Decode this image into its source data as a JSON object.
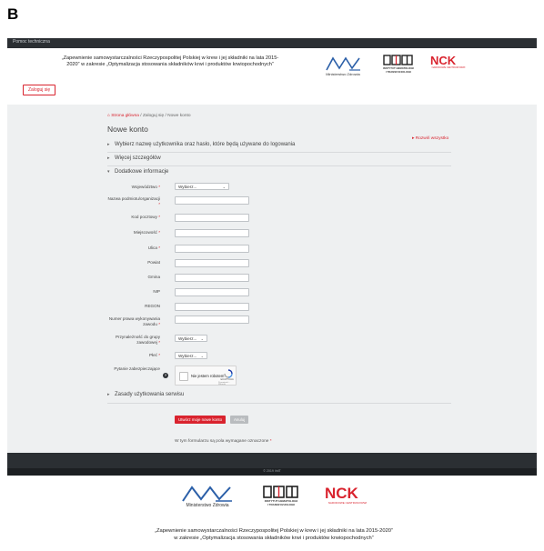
{
  "panel_letter": "B",
  "topbar": {
    "help_label": "Pomoc techniczna"
  },
  "header": {
    "tagline_line1": "„Zapewnienie samowystarczalności Rzeczypospolitej Polskiej w krew i jej składniki na lata 2015-",
    "tagline_line2": "2020” w zakresie „Optymalizacja stosowania składników krwi i produktów krwiopochodnych”",
    "login_button": "Zaloguj się",
    "logos": {
      "mz_caption": "Ministerstwo Zdrowia",
      "iht_line1": "INSTYTUT HEMATOLOGII",
      "iht_line2": "I TRANSFUZJOLOGII",
      "nck_caption": "NARODOWE CENTRUM KRWI"
    }
  },
  "breadcrumb": {
    "home": "Strona główna",
    "sep": "/",
    "login": "Zaloguj się",
    "current": "Nowe konto"
  },
  "page_title": "Nowe konto",
  "expand_all": "Rozwiń wszystko",
  "sections": {
    "username": "Wybierz nazwę użytkownika oraz hasło, które będą używane do logowania",
    "more_details": "Więcej szczegółów",
    "additional": "Dodatkowe informacje",
    "terms": "Zasady użytkowania serwisu"
  },
  "form": {
    "wojewodztwo": "Województwo",
    "nazwa_podmiotu": "Nazwa podmiotu/organizacji",
    "kod_pocztowy": "Kod pocztowy",
    "miejscowosc": "Miejscowość",
    "ulica": "Ulica",
    "powiat": "Powiat",
    "gmina": "Gmina",
    "nip": "NIP",
    "regon": "REGON",
    "numer_prawa": "Numer prawa wykonywania zawodu",
    "przynaleznosc": "Przynależność do grupy zawodowej",
    "plec": "Płeć",
    "pytanie": "Pytanie zabezpieczające",
    "select_placeholder": "Wybierz...",
    "required_mark": "*"
  },
  "captcha": {
    "label": "Nie jestem robotem",
    "brand": "reCAPTCHA",
    "terms": "Prywatność - Warunki"
  },
  "buttons": {
    "create": "Utwórz moje nowe konto",
    "cancel": "Anuluj"
  },
  "required_note": "W tym formularzu są pola wymagane oznaczone",
  "footer": {
    "copyright": "© 2019 ihtiT"
  },
  "bottom_tagline": {
    "line1": "„Zapewnienie samowystarczalności Rzeczypospolitej Polskiej w krew i jej składniki na lata 2015-2020”",
    "line2": "w zakresie „Optymalizacja stosowania składników krwi i produktów krwiopochodnych”"
  },
  "colors": {
    "accent": "#d9232e",
    "dark": "#2b2f33",
    "content_bg": "#eef0f1",
    "mz_blue": "#2b5fa8"
  }
}
